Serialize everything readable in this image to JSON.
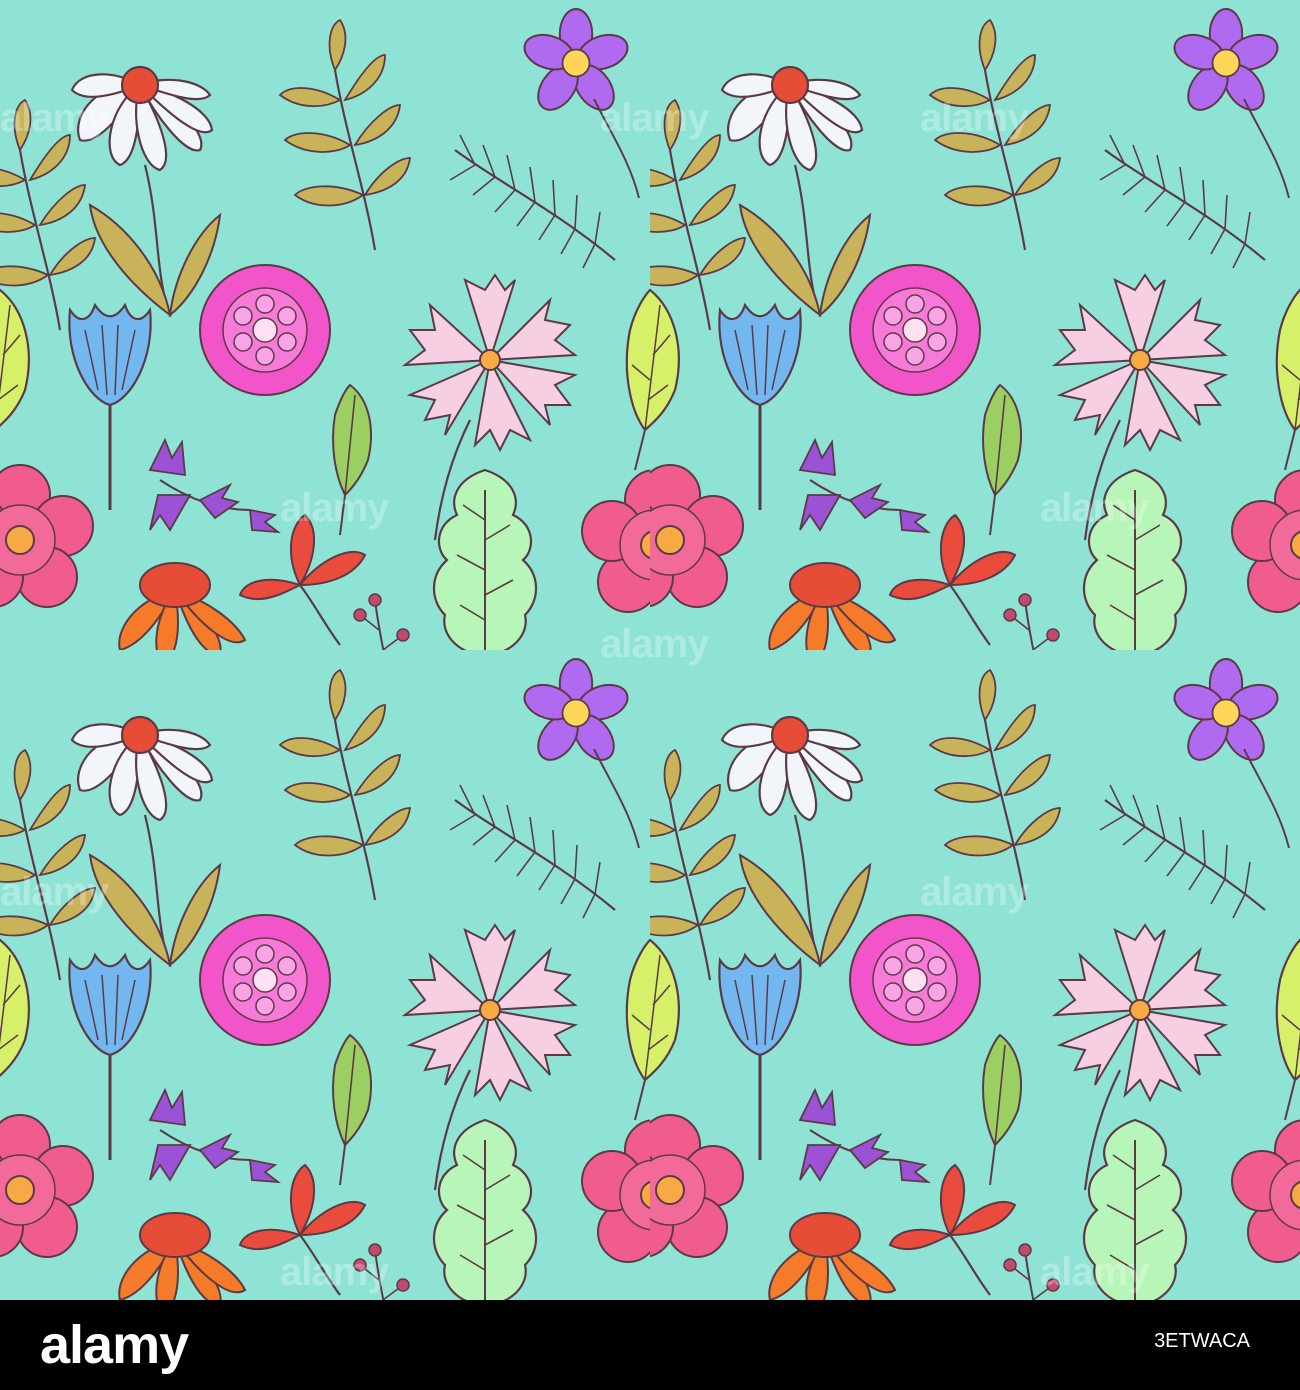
{
  "image": {
    "background_color": "#8fe3d4",
    "description_colors": {
      "outline": "#5b3a46",
      "daisy_petal": "#f2f6fb",
      "daisy_center": "#e64d37",
      "violet_petal": "#b06af0",
      "violet_center": "#ffd65a",
      "pink_zinnia": "#f255c9",
      "pink_cosmos": "#f6cfe2",
      "blue_tulip": "#72b7ef",
      "coral_anemone": "#f05c8e",
      "orange_coneflower": "#f57b2b",
      "red_petals": "#e94b3c",
      "olive_leaf": "#c9b35a",
      "mint_leaf": "#b8f5b8",
      "lime_leaf": "#d7f06a",
      "berry": "#c24a6c"
    }
  },
  "watermark": {
    "text": "alamy"
  },
  "footer": {
    "logo_text": "alamy",
    "image_id": "3ETWACA"
  }
}
